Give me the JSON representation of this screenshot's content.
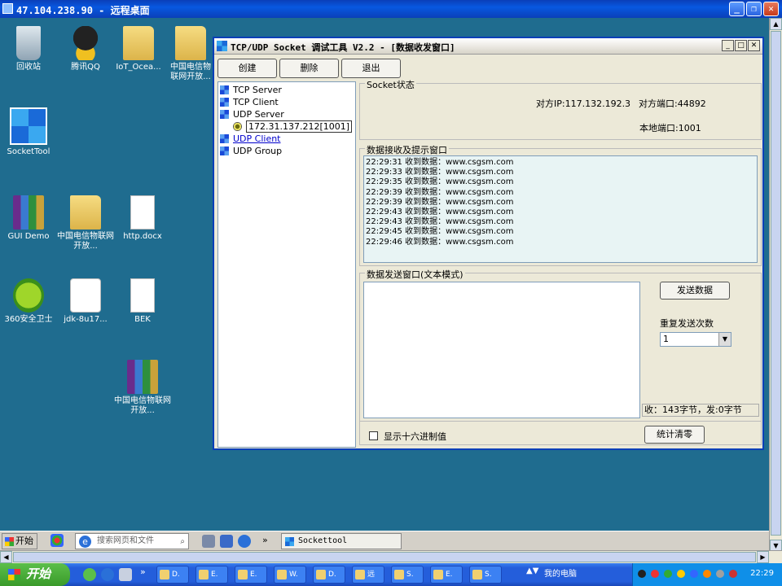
{
  "rdp": {
    "title": "47.104.238.90 - 远程桌面",
    "min": "_",
    "restore": "❐",
    "close": "✕"
  },
  "desktop_icons": [
    {
      "label": "回收站"
    },
    {
      "label": "腾讯QQ"
    },
    {
      "label": "IoT_Ocea..."
    },
    {
      "label": "中国电信物联网开放..."
    },
    {
      "label": "SocketTool"
    },
    {
      "label": "GUI Demo"
    },
    {
      "label": "中国电信物联网开放..."
    },
    {
      "label": "http.docx"
    },
    {
      "label": "360安全卫士"
    },
    {
      "label": "jdk-8u17..."
    },
    {
      "label": "BEK"
    },
    {
      "label": "中国电信物联网开放..."
    }
  ],
  "app": {
    "title": "TCP/UDP Socket 调试工具 V2.2 - [数据收发窗口]",
    "toolbar": {
      "create": "创建",
      "delete": "删除",
      "exit": "退出"
    },
    "tree": {
      "tcp_server": "TCP Server",
      "tcp_client": "TCP Client",
      "udp_server": "UDP Server",
      "udp_server_child": "172.31.137.212[1001]",
      "udp_client": "UDP Client",
      "udp_group": "UDP Group"
    },
    "socket_group": {
      "label": "Socket状态",
      "peer_ip": "对方IP:117.132.192.3",
      "peer_port": "对方端口:44892",
      "local_port": "本地端口:1001"
    },
    "recv_group": {
      "label": "数据接收及提示窗口",
      "lines": [
        "22:29:31 收到数据：www.csgsm.com",
        "22:29:33 收到数据：www.csgsm.com",
        "22:29:35 收到数据：www.csgsm.com",
        "22:29:39 收到数据：www.csgsm.com",
        "22:29:39 收到数据：www.csgsm.com",
        "22:29:43 收到数据：www.csgsm.com",
        "22:29:43 收到数据：www.csgsm.com",
        "22:29:45 收到数据：www.csgsm.com",
        "22:29:46 收到数据：www.csgsm.com"
      ]
    },
    "send_group": {
      "label": "数据发送窗口(文本模式)",
      "send_button": "发送数据",
      "repeat_label": "重复发送次数",
      "repeat_value": "1",
      "counts": "收：143字节，发:0字节"
    },
    "bottom": {
      "hex_label": "显示十六进制值",
      "clear_button": "统计清零"
    }
  },
  "inner_taskbar": {
    "start": "开始",
    "search_placeholder": "搜索网页和文件",
    "more": "»",
    "task": "Sockettool"
  },
  "xp_taskbar": {
    "start": "开始",
    "more": "»",
    "tasks": [
      "D.",
      "E.",
      "E.",
      "W.",
      "D.",
      "远",
      "S.",
      "E.",
      "S."
    ],
    "search": "我的电脑",
    "clock": "22:29"
  }
}
